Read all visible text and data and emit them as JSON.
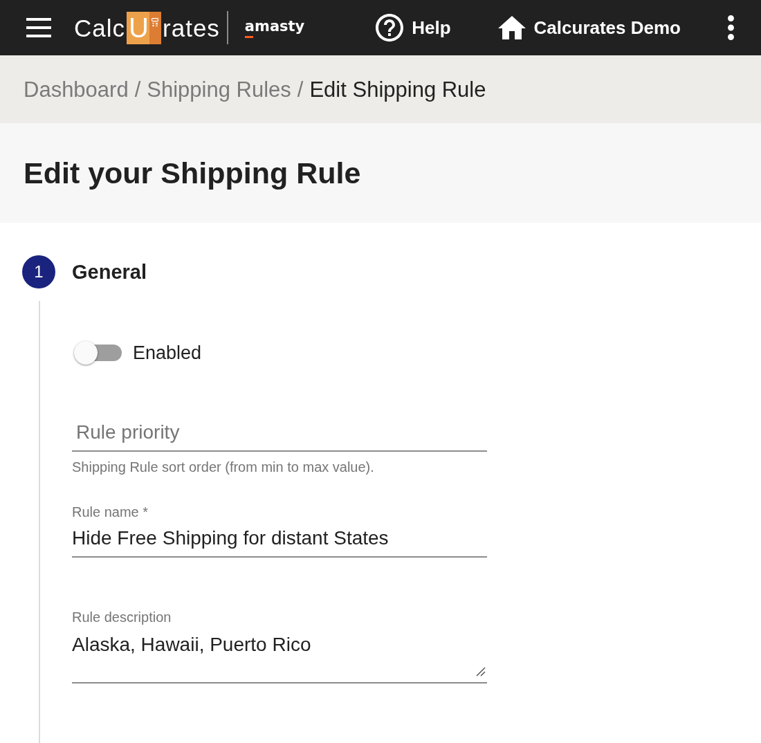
{
  "top_bar": {
    "logo": {
      "before": "Calc",
      "tile_letter": "U",
      "after": "rates"
    },
    "partner_logo": "amasty",
    "help": "Help",
    "store": "Calcurates Demo"
  },
  "breadcrumbs": [
    {
      "label": "Dashboard",
      "current": false,
      "separator": "/"
    },
    {
      "label": "Shipping Rules",
      "current": false,
      "separator": "/"
    },
    {
      "label": "Edit Shipping Rule",
      "current": true
    }
  ],
  "page_title": "Edit your Shipping Rule",
  "step": {
    "number": "1",
    "title": "General",
    "toggle": {
      "label": "Enabled",
      "on": false
    },
    "fields": [
      {
        "kind": "input",
        "placeholder": "Rule priority",
        "helper": "Shipping Rule sort order (from min to max value)."
      },
      {
        "kind": "input",
        "label": "Rule name *",
        "value": "Hide Free Shipping for distant States"
      },
      {
        "kind": "textarea",
        "label": "Rule description",
        "value": "Alaska, Hawaii, Puerto Rico"
      }
    ]
  }
}
